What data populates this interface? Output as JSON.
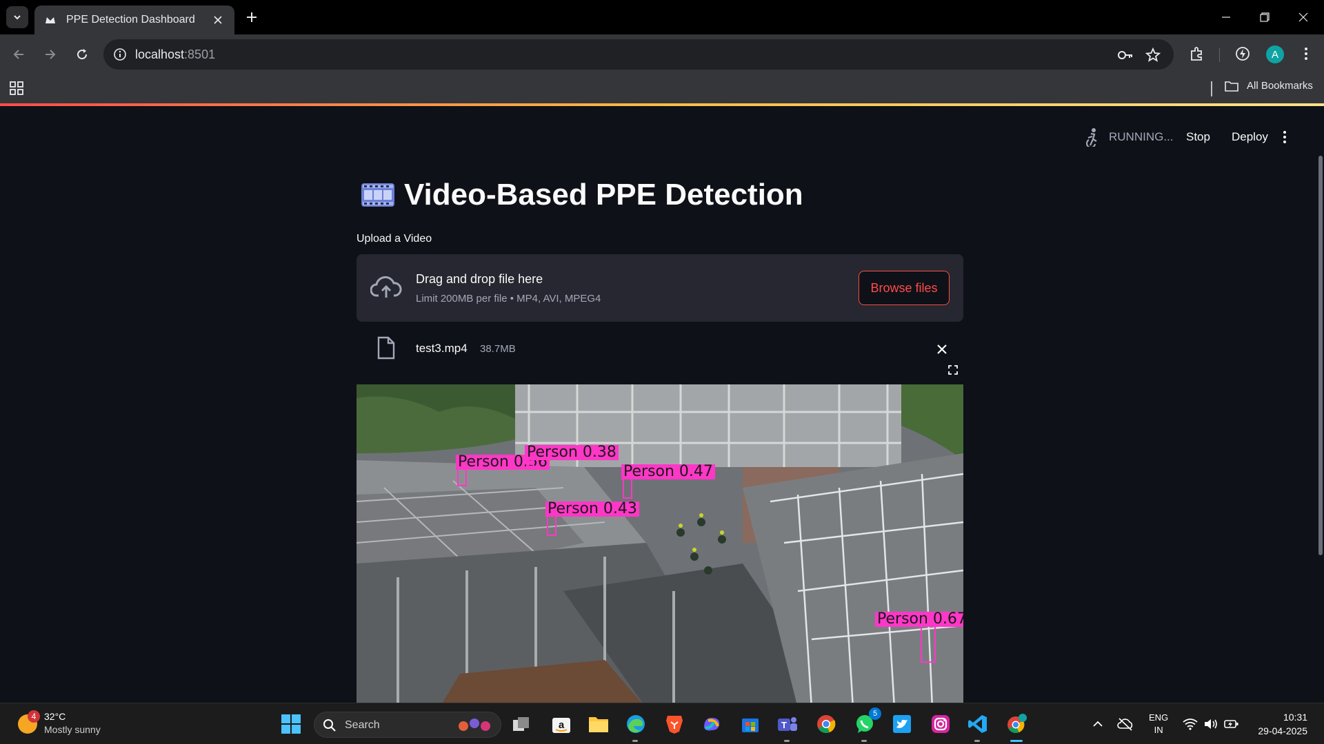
{
  "browser": {
    "tab_title": "PPE Detection Dashboard",
    "url_host": "localhost",
    "url_port": ":8501",
    "bookmarks_label": "All Bookmarks",
    "profile_initial": "A"
  },
  "app": {
    "status": "RUNNING...",
    "stop_label": "Stop",
    "deploy_label": "Deploy",
    "title": "Video-Based PPE Detection",
    "upload_label": "Upload a Video",
    "dropzone_title": "Drag and drop file here",
    "dropzone_limit": "Limit 200MB per file • MP4, AVI, MPEG4",
    "browse_label": "Browse files",
    "file_name": "test3.mp4",
    "file_size": "38.7MB",
    "detections": [
      {
        "label": "Person 0.56"
      },
      {
        "label": "Person 0.38"
      },
      {
        "label": "Person 0.47"
      },
      {
        "label": "Person 0.43"
      },
      {
        "label": "Person 0.67"
      }
    ]
  },
  "taskbar": {
    "weather_temp": "32°C",
    "weather_condition": "Mostly sunny",
    "weather_badge": "4",
    "search_placeholder": "Search",
    "whatsapp_badge": "5",
    "lang_line1": "ENG",
    "lang_line2": "IN",
    "time": "10:31",
    "date": "29-04-2025"
  }
}
